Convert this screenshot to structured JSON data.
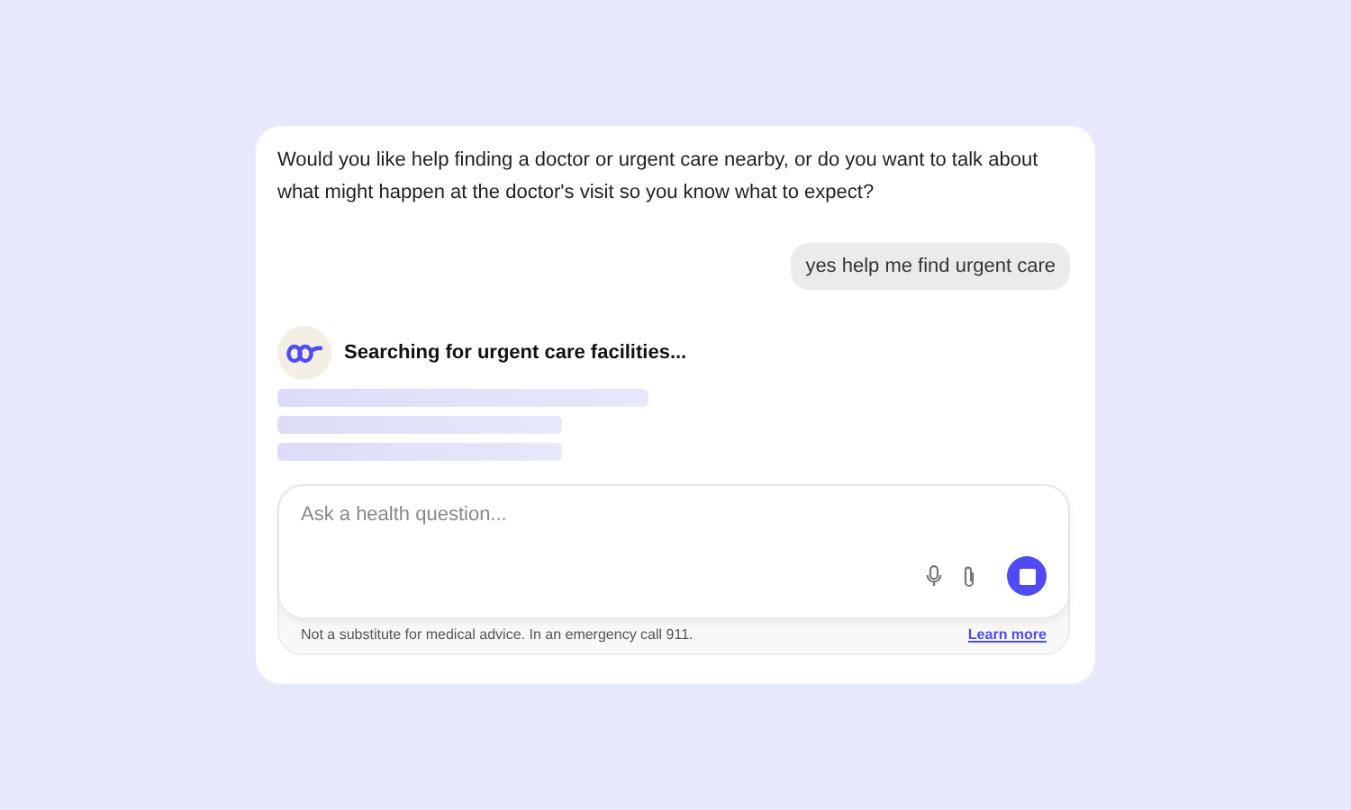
{
  "messages": [
    {
      "kind": "assistant",
      "text": "Would you like help finding a doctor or urgent care nearby, or do you want to talk about what might happen at the doctor's visit so you know what to expect?"
    },
    {
      "kind": "user",
      "text": "yes help me find urgent care"
    }
  ],
  "status": {
    "text": "Searching for urgent care facilities..."
  },
  "composer": {
    "placeholder": "Ask a health question..."
  },
  "footer": {
    "disclaimer": "Not a substitute for medical advice. In an emergency call 911.",
    "link": "Learn more"
  }
}
